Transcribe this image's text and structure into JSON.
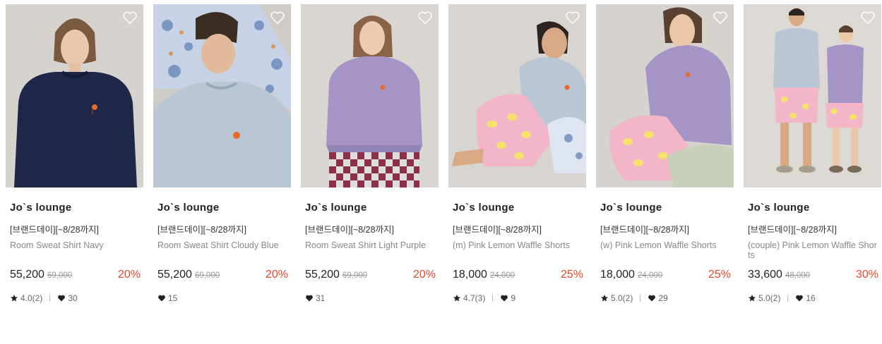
{
  "products": [
    {
      "brand": "Jo`s lounge",
      "promo": "[브랜드데이][~8/28까지]",
      "name": "Room Sweat Shirt Navy",
      "price": "55,200",
      "original_price": "69,000",
      "discount": "20%",
      "rating": "4.0(2)",
      "likes": "30",
      "icons": {
        "wishlist": "heart-outline-icon",
        "rating": "star-icon",
        "likes": "heart-icon"
      }
    },
    {
      "brand": "Jo`s lounge",
      "promo": "[브랜드데이][~8/28까지]",
      "name": "Room Sweat Shirt Cloudy Blue",
      "price": "55,200",
      "original_price": "69,000",
      "discount": "20%",
      "rating": "",
      "likes": "15",
      "icons": {
        "wishlist": "heart-outline-icon",
        "likes": "heart-icon"
      }
    },
    {
      "brand": "Jo`s lounge",
      "promo": "[브랜드데이][~8/28까지]",
      "name": "Room Sweat Shirt Light Purple",
      "price": "55,200",
      "original_price": "69,000",
      "discount": "20%",
      "rating": "",
      "likes": "31",
      "icons": {
        "wishlist": "heart-outline-icon",
        "likes": "heart-icon"
      }
    },
    {
      "brand": "Jo`s lounge",
      "promo": "[브랜드데이][~8/28까지]",
      "name": "(m) Pink Lemon Waffle Shorts",
      "price": "18,000",
      "original_price": "24,000",
      "discount": "25%",
      "rating": "4.7(3)",
      "likes": "9",
      "icons": {
        "wishlist": "heart-outline-icon",
        "rating": "star-icon",
        "likes": "heart-icon"
      }
    },
    {
      "brand": "Jo`s lounge",
      "promo": "[브랜드데이][~8/28까지]",
      "name": "(w) Pink Lemon Waffle Shorts",
      "price": "18,000",
      "original_price": "24,000",
      "discount": "25%",
      "rating": "5.0(2)",
      "likes": "29",
      "icons": {
        "wishlist": "heart-outline-icon",
        "rating": "star-icon",
        "likes": "heart-icon"
      }
    },
    {
      "brand": "Jo`s lounge",
      "promo": "[브랜드데이][~8/28까지]",
      "name": "(couple) Pink Lemon Waffle Shorts",
      "price": "33,600",
      "original_price": "48,000",
      "discount": "30%",
      "rating": "5.0(2)",
      "likes": "16",
      "icons": {
        "wishlist": "heart-outline-icon",
        "rating": "star-icon",
        "likes": "heart-icon"
      }
    }
  ],
  "colors": {
    "discount": "#e8472c",
    "price": "#222222",
    "original_price": "#999999",
    "name": "#888888",
    "navy_sweat": "#1f2748",
    "blue_sweat": "#b9c6d3",
    "purple_sweat": "#a495c6",
    "lemon_print": "#f3b6c8"
  }
}
